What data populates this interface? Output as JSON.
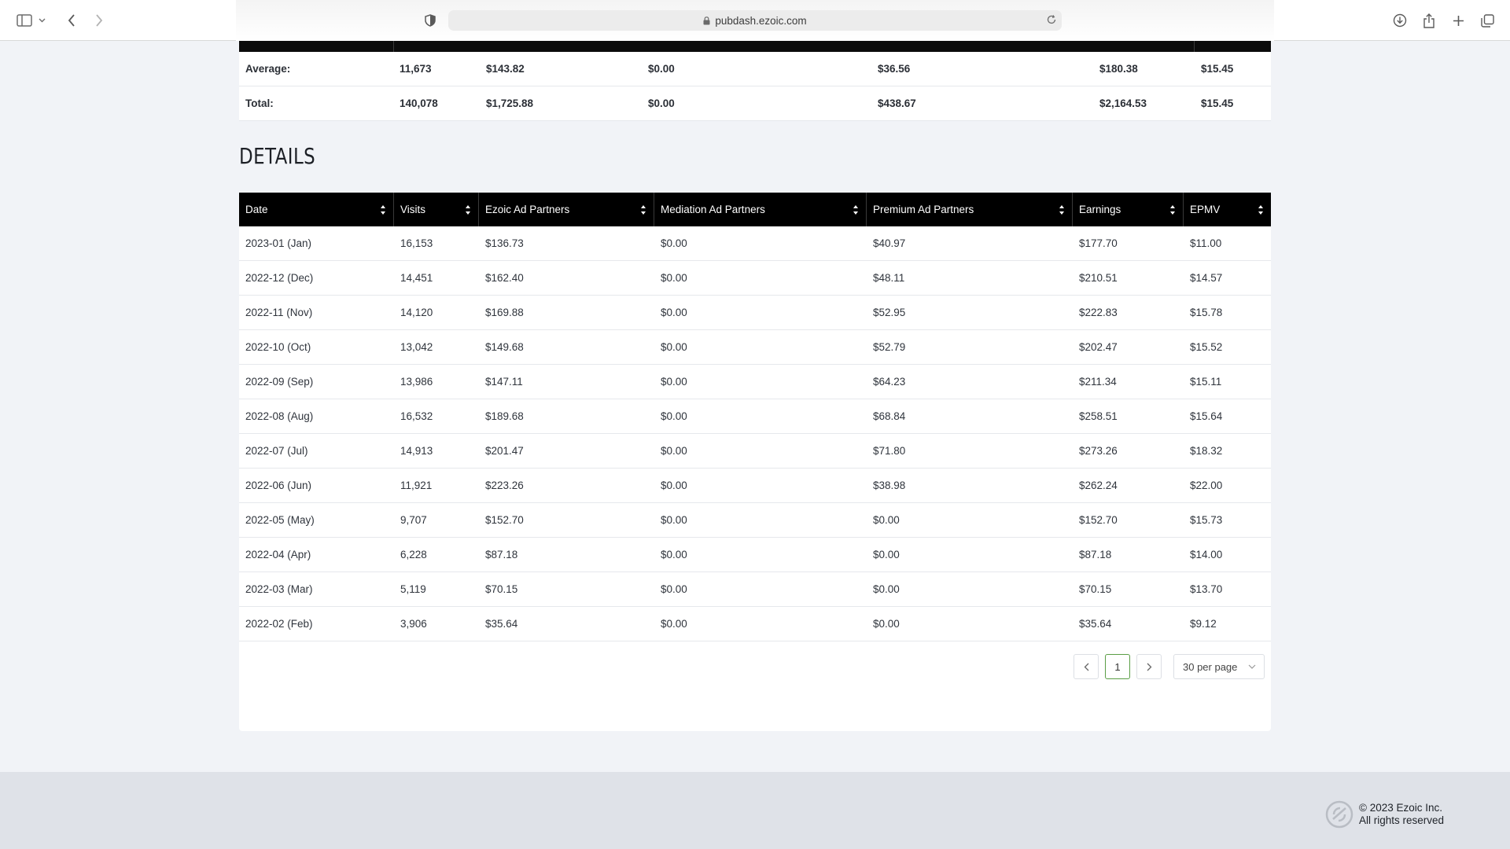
{
  "browser": {
    "url": "pubdash.ezoic.com"
  },
  "summary": {
    "rows": [
      {
        "label": "Average:",
        "visits": "11,673",
        "ezoic": "$143.82",
        "mediation": "$0.00",
        "premium": "$36.56",
        "earnings": "$180.38",
        "epmv": "$15.45"
      },
      {
        "label": "Total:",
        "visits": "140,078",
        "ezoic": "$1,725.88",
        "mediation": "$0.00",
        "premium": "$438.67",
        "earnings": "$2,164.53",
        "epmv": "$15.45"
      }
    ]
  },
  "details": {
    "title": "DETAILS",
    "columns": [
      "Date",
      "Visits",
      "Ezoic Ad Partners",
      "Mediation Ad Partners",
      "Premium Ad Partners",
      "Earnings",
      "EPMV"
    ],
    "rows": [
      [
        "2023-01 (Jan)",
        "16,153",
        "$136.73",
        "$0.00",
        "$40.97",
        "$177.70",
        "$11.00"
      ],
      [
        "2022-12 (Dec)",
        "14,451",
        "$162.40",
        "$0.00",
        "$48.11",
        "$210.51",
        "$14.57"
      ],
      [
        "2022-11 (Nov)",
        "14,120",
        "$169.88",
        "$0.00",
        "$52.95",
        "$222.83",
        "$15.78"
      ],
      [
        "2022-10 (Oct)",
        "13,042",
        "$149.68",
        "$0.00",
        "$52.79",
        "$202.47",
        "$15.52"
      ],
      [
        "2022-09 (Sep)",
        "13,986",
        "$147.11",
        "$0.00",
        "$64.23",
        "$211.34",
        "$15.11"
      ],
      [
        "2022-08 (Aug)",
        "16,532",
        "$189.68",
        "$0.00",
        "$68.84",
        "$258.51",
        "$15.64"
      ],
      [
        "2022-07 (Jul)",
        "14,913",
        "$201.47",
        "$0.00",
        "$71.80",
        "$273.26",
        "$18.32"
      ],
      [
        "2022-06 (Jun)",
        "11,921",
        "$223.26",
        "$0.00",
        "$38.98",
        "$262.24",
        "$22.00"
      ],
      [
        "2022-05 (May)",
        "9,707",
        "$152.70",
        "$0.00",
        "$0.00",
        "$152.70",
        "$15.73"
      ],
      [
        "2022-04 (Apr)",
        "6,228",
        "$87.18",
        "$0.00",
        "$0.00",
        "$87.18",
        "$14.00"
      ],
      [
        "2022-03 (Mar)",
        "5,119",
        "$70.15",
        "$0.00",
        "$0.00",
        "$70.15",
        "$13.70"
      ],
      [
        "2022-02 (Feb)",
        "3,906",
        "$35.64",
        "$0.00",
        "$0.00",
        "$35.64",
        "$9.12"
      ]
    ]
  },
  "pagination": {
    "current_page": "1",
    "per_page": "30 per page"
  },
  "footer": {
    "copyright": "© 2023 Ezoic Inc.",
    "rights": "All rights reserved"
  },
  "colors": {
    "header_bg": "#000000",
    "page_bg": "#f1f3f7",
    "active_page_border": "#5a9e45"
  }
}
